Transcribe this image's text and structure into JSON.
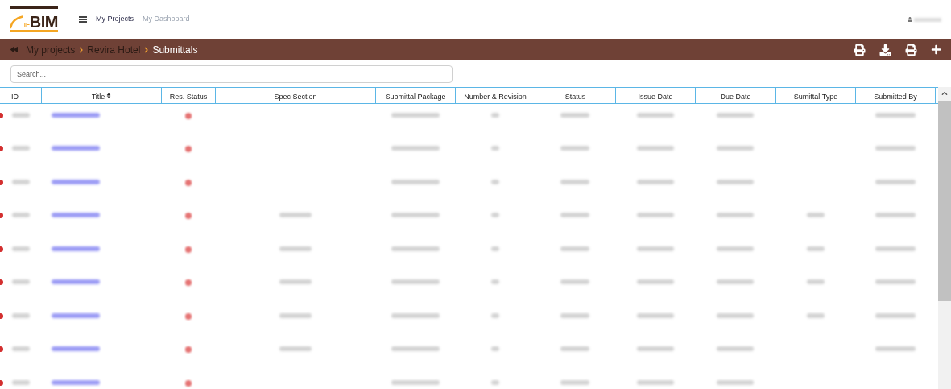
{
  "logo": {
    "small": "iF",
    "large": "BIM"
  },
  "nav": [
    {
      "label": "My Projects",
      "selected": true
    },
    {
      "label": "My Dashboard",
      "selected": false
    }
  ],
  "breadcrumb": [
    {
      "label": "My projects",
      "current": false
    },
    {
      "label": "Revira Hotel",
      "current": false
    },
    {
      "label": "Submittals",
      "current": true
    }
  ],
  "search": {
    "placeholder": "Search..."
  },
  "table": {
    "columns": [
      {
        "label": "ID",
        "sortable": false
      },
      {
        "label": "Title",
        "sortable": true
      },
      {
        "label": "Res. Status",
        "sortable": false
      },
      {
        "label": "Spec Section",
        "sortable": false
      },
      {
        "label": "Submittal Package",
        "sortable": false
      },
      {
        "label": "Number & Revision",
        "sortable": false
      },
      {
        "label": "Status",
        "sortable": false
      },
      {
        "label": "Issue Date",
        "sortable": false
      },
      {
        "label": "Due Date",
        "sortable": false
      },
      {
        "label": "Sumittal Type",
        "sortable": false
      },
      {
        "label": "Submitted By",
        "sortable": false
      }
    ],
    "rows": [
      {
        "cells": [
          {
            "kind": "blurred"
          },
          {
            "kind": "blurred_link"
          },
          {
            "kind": "dot"
          },
          {
            "kind": "blank"
          },
          {
            "kind": "blurred"
          },
          {
            "kind": "blurred"
          },
          {
            "kind": "blurred"
          },
          {
            "kind": "blurred"
          },
          {
            "kind": "blurred"
          },
          {
            "kind": "blank"
          },
          {
            "kind": "blurred"
          }
        ]
      },
      {
        "cells": [
          {
            "kind": "blurred"
          },
          {
            "kind": "blurred_link"
          },
          {
            "kind": "dot"
          },
          {
            "kind": "blank"
          },
          {
            "kind": "blurred"
          },
          {
            "kind": "blurred"
          },
          {
            "kind": "blurred"
          },
          {
            "kind": "blurred"
          },
          {
            "kind": "blurred"
          },
          {
            "kind": "blank"
          },
          {
            "kind": "blurred"
          }
        ]
      },
      {
        "cells": [
          {
            "kind": "blurred"
          },
          {
            "kind": "blurred_link"
          },
          {
            "kind": "dot"
          },
          {
            "kind": "blank"
          },
          {
            "kind": "blurred"
          },
          {
            "kind": "blurred"
          },
          {
            "kind": "blurred"
          },
          {
            "kind": "blurred"
          },
          {
            "kind": "blurred"
          },
          {
            "kind": "blank"
          },
          {
            "kind": "blurred"
          }
        ]
      },
      {
        "cells": [
          {
            "kind": "blurred"
          },
          {
            "kind": "blurred_link"
          },
          {
            "kind": "dot"
          },
          {
            "kind": "blurred"
          },
          {
            "kind": "blurred"
          },
          {
            "kind": "blurred"
          },
          {
            "kind": "blurred"
          },
          {
            "kind": "blurred"
          },
          {
            "kind": "blurred"
          },
          {
            "kind": "blurred"
          },
          {
            "kind": "blurred"
          }
        ]
      },
      {
        "cells": [
          {
            "kind": "blurred"
          },
          {
            "kind": "blurred_link"
          },
          {
            "kind": "dot"
          },
          {
            "kind": "blurred"
          },
          {
            "kind": "blurred"
          },
          {
            "kind": "blurred"
          },
          {
            "kind": "blurred"
          },
          {
            "kind": "blurred"
          },
          {
            "kind": "blurred"
          },
          {
            "kind": "blurred"
          },
          {
            "kind": "blurred"
          }
        ]
      },
      {
        "cells": [
          {
            "kind": "blurred"
          },
          {
            "kind": "blurred_link"
          },
          {
            "kind": "dot"
          },
          {
            "kind": "blurred"
          },
          {
            "kind": "blurred"
          },
          {
            "kind": "blurred"
          },
          {
            "kind": "blurred"
          },
          {
            "kind": "blurred"
          },
          {
            "kind": "blurred"
          },
          {
            "kind": "blurred"
          },
          {
            "kind": "blurred"
          }
        ]
      },
      {
        "cells": [
          {
            "kind": "blurred"
          },
          {
            "kind": "blurred_link"
          },
          {
            "kind": "dot"
          },
          {
            "kind": "blurred"
          },
          {
            "kind": "blurred"
          },
          {
            "kind": "blurred"
          },
          {
            "kind": "blurred"
          },
          {
            "kind": "blurred"
          },
          {
            "kind": "blurred"
          },
          {
            "kind": "blurred"
          },
          {
            "kind": "blurred"
          }
        ]
      },
      {
        "cells": [
          {
            "kind": "blurred"
          },
          {
            "kind": "blurred_link"
          },
          {
            "kind": "dot"
          },
          {
            "kind": "blurred"
          },
          {
            "kind": "blurred"
          },
          {
            "kind": "blurred"
          },
          {
            "kind": "blurred"
          },
          {
            "kind": "blurred"
          },
          {
            "kind": "blurred"
          },
          {
            "kind": "blank"
          },
          {
            "kind": "blurred"
          }
        ]
      },
      {
        "cells": [
          {
            "kind": "blurred"
          },
          {
            "kind": "blurred_link"
          },
          {
            "kind": "dot"
          },
          {
            "kind": "blank"
          },
          {
            "kind": "blurred"
          },
          {
            "kind": "blurred"
          },
          {
            "kind": "blurred"
          },
          {
            "kind": "blurred"
          },
          {
            "kind": "blurred"
          },
          {
            "kind": "blank"
          },
          {
            "kind": "blank"
          }
        ]
      }
    ]
  }
}
